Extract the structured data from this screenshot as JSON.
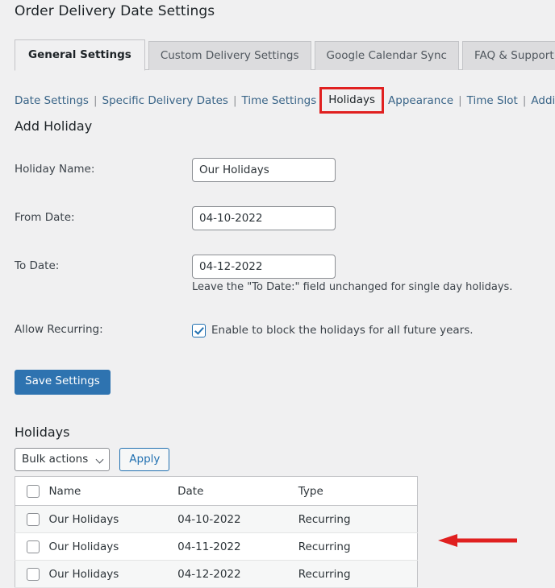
{
  "page": {
    "title": "Order Delivery Date Settings"
  },
  "tabs": [
    {
      "label": "General Settings",
      "active": true
    },
    {
      "label": "Custom Delivery Settings",
      "active": false
    },
    {
      "label": "Google Calendar Sync",
      "active": false
    },
    {
      "label": "FAQ & Support",
      "active": false
    }
  ],
  "subnav": {
    "links": [
      {
        "label": "Date Settings",
        "current": false
      },
      {
        "label": "Specific Delivery Dates",
        "current": false
      },
      {
        "label": "Time Settings",
        "current": false
      },
      {
        "label": "Holidays",
        "current": true
      },
      {
        "label": "Appearance",
        "current": false
      },
      {
        "label": "Time Slot",
        "current": false
      },
      {
        "label": "Additional Settings",
        "current": false
      }
    ],
    "separator": "|",
    "highlight_color": "#e02020",
    "link_color": "#3a6588"
  },
  "add_holiday": {
    "heading": "Add Holiday",
    "fields": {
      "holiday_name": {
        "label": "Holiday Name:",
        "value": "Our Holidays",
        "placeholder": ""
      },
      "from_date": {
        "label": "From Date:",
        "value": "04-10-2022",
        "placeholder": ""
      },
      "to_date": {
        "label": "To Date:",
        "value": "04-12-2022",
        "placeholder": "",
        "hint": "Leave the \"To Date:\" field unchanged for single day holidays."
      },
      "allow_recurring": {
        "label": "Allow Recurring:",
        "checkbox_label": "Enable to block the holidays for all future years.",
        "checked": true
      }
    },
    "save_label": "Save Settings",
    "save_color": "#2e73b0"
  },
  "holidays_list": {
    "heading": "Holidays",
    "bulk_actions_label": "Bulk actions",
    "apply_label": "Apply",
    "columns": [
      "Name",
      "Date",
      "Type"
    ],
    "rows": [
      {
        "name": "Our Holidays",
        "date": "04-10-2022",
        "type": "Recurring"
      },
      {
        "name": "Our Holidays",
        "date": "04-11-2022",
        "type": "Recurring"
      },
      {
        "name": "Our Holidays",
        "date": "04-12-2022",
        "type": "Recurring"
      }
    ]
  },
  "annotation": {
    "arrow_color": "#e02020",
    "direction": "left"
  }
}
